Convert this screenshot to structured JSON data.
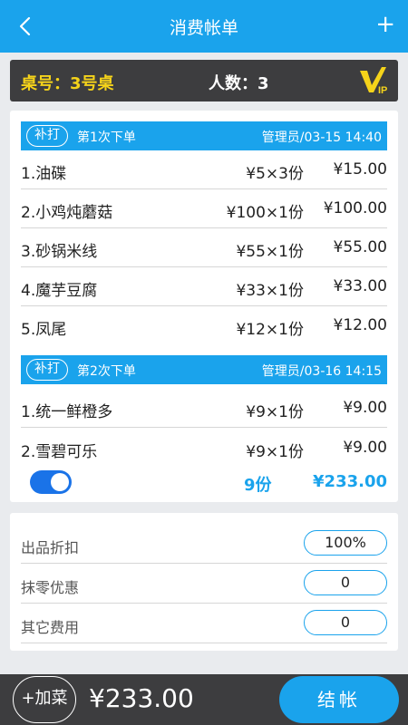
{
  "header": {
    "title": "消费帐单",
    "back_icon": "chevron-left-icon",
    "add_label": "+"
  },
  "table_info": {
    "table_no": "桌号：3号桌",
    "people": "人数：3",
    "vip_badge": "VIP"
  },
  "orders": [
    {
      "tag": "补打",
      "seq": "第1次下单",
      "meta": "管理员/03-15 14:40",
      "items": [
        {
          "name": "1.油碟",
          "qty": "¥5×3份",
          "amount": "¥15.00"
        },
        {
          "name": "2.小鸡炖蘑菇",
          "qty": "¥100×1份",
          "amount": "¥100.00"
        },
        {
          "name": "3.砂锅米线",
          "qty": "¥55×1份",
          "amount": "¥55.00"
        },
        {
          "name": "4.魔芋豆腐",
          "qty": "¥33×1份",
          "amount": "¥33.00"
        },
        {
          "name": "5.凤尾",
          "qty": "¥12×1份",
          "amount": "¥12.00"
        }
      ]
    },
    {
      "tag": "补打",
      "seq": "第2次下单",
      "meta": "管理员/03-16 14:15",
      "items": [
        {
          "name": "1.统一鲜橙多",
          "qty": "¥9×1份",
          "amount": "¥9.00"
        },
        {
          "name": "2.雪碧可乐",
          "qty": "¥9×1份",
          "amount": "¥9.00"
        }
      ]
    }
  ],
  "summary": {
    "toggle_on": true,
    "count": "9份",
    "total": "¥233.00"
  },
  "adjustments": [
    {
      "label": "出品折扣",
      "value": "100%"
    },
    {
      "label": "抹零优惠",
      "value": "0"
    },
    {
      "label": "其它费用",
      "value": "0"
    }
  ],
  "footer": {
    "add_dish": "+加菜",
    "total": "¥233.00",
    "checkout": "结帐"
  },
  "colors": {
    "accent": "#1aa3ec",
    "dark_bar": "#3d3d3f",
    "table_no": "#f5d31a",
    "toggle": "#1a73e8"
  }
}
